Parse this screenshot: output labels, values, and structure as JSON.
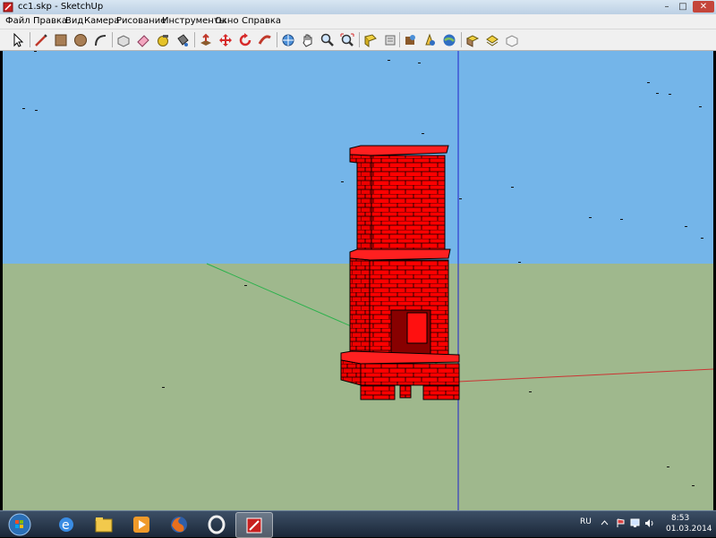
{
  "window": {
    "title": "cc1.skp - SketchUp"
  },
  "controls": {
    "minimize": "–",
    "maximize": "□",
    "close": "✕"
  },
  "menu": {
    "items": [
      "Файл",
      "Правка",
      "Вид",
      "Камера",
      "Рисование",
      "Инструменты",
      "Окно",
      "Справка"
    ]
  },
  "toolbar": {
    "tools": [
      "select-icon",
      "line-icon",
      "rectangle-icon",
      "circle-icon",
      "arc-icon",
      "make-component-icon",
      "eraser-icon",
      "tape-measure-icon",
      "paint-bucket-icon",
      "push-pull-icon",
      "move-icon",
      "rotate-icon",
      "follow-me-icon",
      "orbit-icon",
      "pan-icon",
      "zoom-icon",
      "zoom-extents-icon",
      "3d-warehouse-icon",
      "get-models-icon",
      "share-model-icon",
      "preview-google-earth-icon",
      "toggle-terrain-icon",
      "photo-textures-icon",
      "layers-icon",
      "component-icon",
      "scenes-icon"
    ]
  },
  "viewport": {
    "sky_color": "#74b5e9",
    "ground_color": "#9fb88d",
    "model_color": "#ff0000"
  },
  "taskbar": {
    "apps": [
      "start-orb-icon",
      "ie-icon",
      "explorer-icon",
      "media-player-icon",
      "firefox-icon",
      "opera-icon",
      "sketchup-icon"
    ],
    "language": "RU",
    "time": "8:53",
    "date": "01.03.2014"
  }
}
